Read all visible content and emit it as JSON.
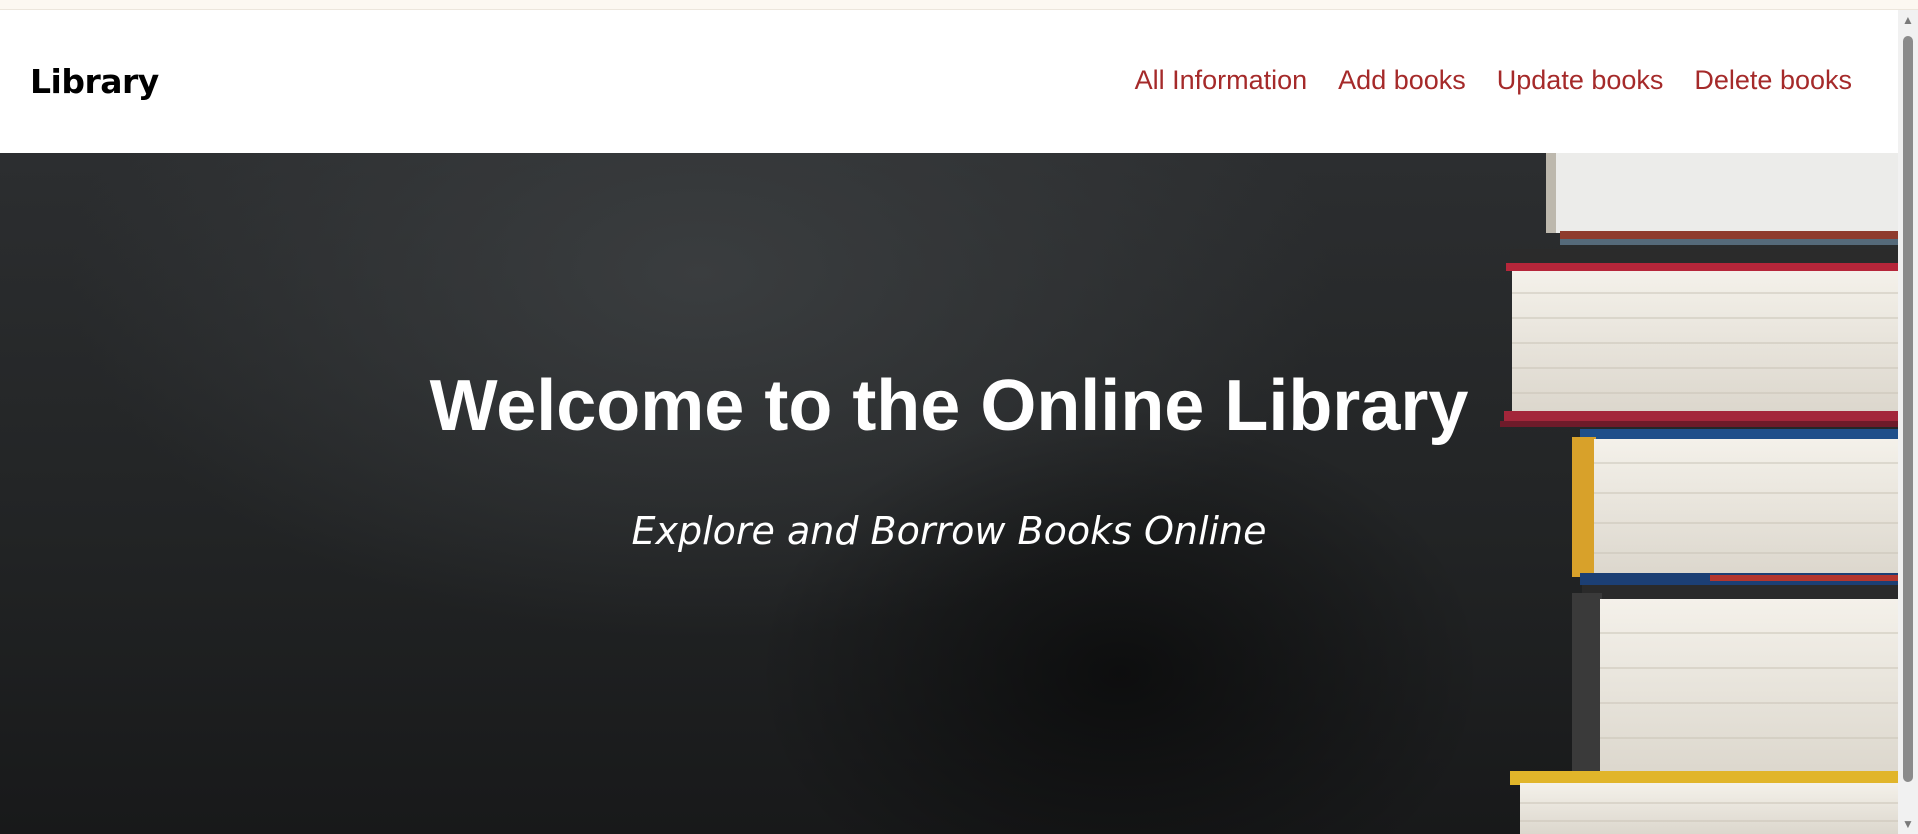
{
  "navbar": {
    "brand": "Library",
    "links": [
      {
        "label": "All Information"
      },
      {
        "label": "Add books"
      },
      {
        "label": "Update books"
      },
      {
        "label": "Delete books"
      }
    ]
  },
  "hero": {
    "title": "Welcome to the Online Library",
    "subtitle": "Explore and Borrow Books Online",
    "image": "stack-of-books-image"
  },
  "colors": {
    "link": "#a52a2a",
    "brand": "#000000",
    "hero_text": "#ffffff",
    "hero_background": "#222425"
  }
}
